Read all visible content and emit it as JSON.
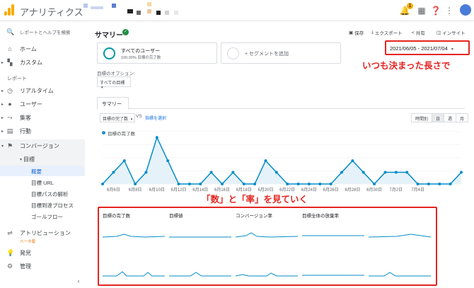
{
  "app": {
    "title": "アナリティクス"
  },
  "topbar": {
    "notification_count": "1"
  },
  "sidebar": {
    "search_placeholder": "レポートとヘルプを検索",
    "home": "ホーム",
    "custom": "カスタム",
    "reports_section": "レポート",
    "realtime": "リアルタイム",
    "audience": "ユーザー",
    "acquisition": "集客",
    "behavior": "行動",
    "conversions": "コンバージョン",
    "goals": "目標",
    "goal_items": [
      "概要",
      "目標 URL",
      "目標パスの解析",
      "目標到達プロセス",
      "ゴールフロー"
    ],
    "attribution": "アトリビューション",
    "beta": "ベータ版",
    "discover": "発見",
    "admin": "管理"
  },
  "header": {
    "title": "サマリー",
    "save": "保存",
    "export": "エクスポート",
    "share": "共有",
    "insights": "インサイト"
  },
  "segments": {
    "all_users": "すべてのユーザー",
    "all_users_sub": "100.00% 目標の完了数",
    "add_segment": "+ セグメントを追加"
  },
  "date_range": "2021/06/05 - 2021/07/04",
  "annotations": {
    "date_note": "いつも決まった長さで",
    "metrics_note": "「数」と「率」を見ていく"
  },
  "goal_options": {
    "label": "目標のオプション:",
    "selected": "すべての目標"
  },
  "tabs": {
    "summary": "サマリー"
  },
  "chart_controls": {
    "metric": "目標の完了数",
    "vs": "VS",
    "compare": "指標を選択",
    "time_buttons": [
      "時間別",
      "日",
      "週",
      "月"
    ],
    "active_time": "日"
  },
  "chart_data": {
    "type": "area",
    "series": [
      {
        "name": "目標の完了数",
        "values": [
          0,
          1,
          2,
          0,
          1,
          4,
          2,
          0,
          0,
          0,
          1,
          0,
          1,
          0,
          0,
          2,
          1,
          0,
          0,
          0,
          0,
          0,
          1,
          2,
          1,
          0,
          1,
          1,
          1,
          0,
          0,
          0,
          0,
          1
        ]
      }
    ],
    "x_labels": [
      "6月6日",
      "6月8日",
      "6月10日",
      "6月12日",
      "6月14日",
      "6月16日",
      "6月18日",
      "6月20日",
      "6月22日",
      "6月24日",
      "6月26日",
      "6月28日",
      "6月30日",
      "7月2日",
      "7月4日"
    ],
    "ylim": [
      0,
      4.5
    ],
    "colors": {
      "line": "#058dc7",
      "fill": "#e6f2f9"
    }
  },
  "metric_cards": [
    {
      "title": "目標の完了数"
    },
    {
      "title": "目標値"
    },
    {
      "title": "コンバージョン率"
    },
    {
      "title": "目標全体の放棄率"
    }
  ],
  "colors": {
    "accent": "#1a73e8",
    "annotation": "#e52521",
    "brand": "#f9ab00"
  }
}
